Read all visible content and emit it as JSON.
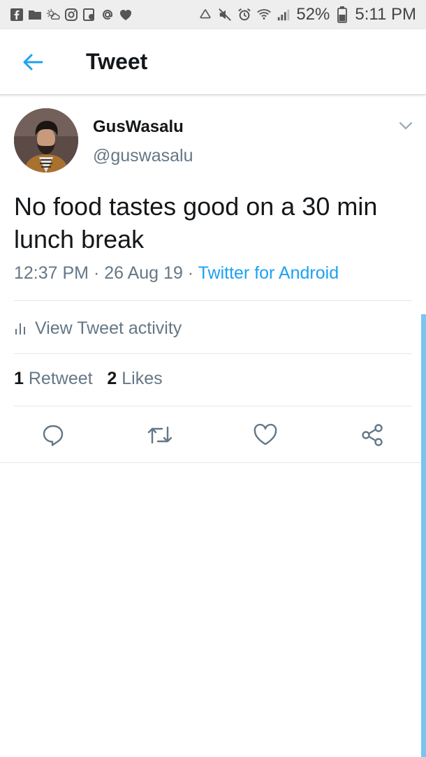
{
  "status_bar": {
    "left_icons": [
      "facebook-icon",
      "folder-icon",
      "weather-icon",
      "instagram-icon",
      "gallery-icon",
      "at-sign-icon",
      "heart-icon"
    ],
    "right_icons": [
      "recycle-icon",
      "mute-icon",
      "alarm-icon",
      "wifi-icon",
      "signal-icon",
      "battery-icon"
    ],
    "battery": "52%",
    "time": "5:11 PM"
  },
  "header": {
    "title": "Tweet"
  },
  "tweet": {
    "display_name": "GusWasalu",
    "handle": "@guswasalu",
    "text": "No food tastes good on a 30 min lunch break",
    "time": "12:37 PM",
    "date": "26 Aug 19",
    "source": "Twitter for Android",
    "activity_label": "View Tweet activity",
    "retweet_count": "1",
    "retweet_label": "Retweet",
    "like_count": "2",
    "like_label": "Likes"
  },
  "colors": {
    "accent": "#1da1f2",
    "secondary_text": "#657786",
    "primary_text": "#14171a",
    "divider": "#e1e8ed",
    "scrollbar": "#7cc4f0"
  }
}
